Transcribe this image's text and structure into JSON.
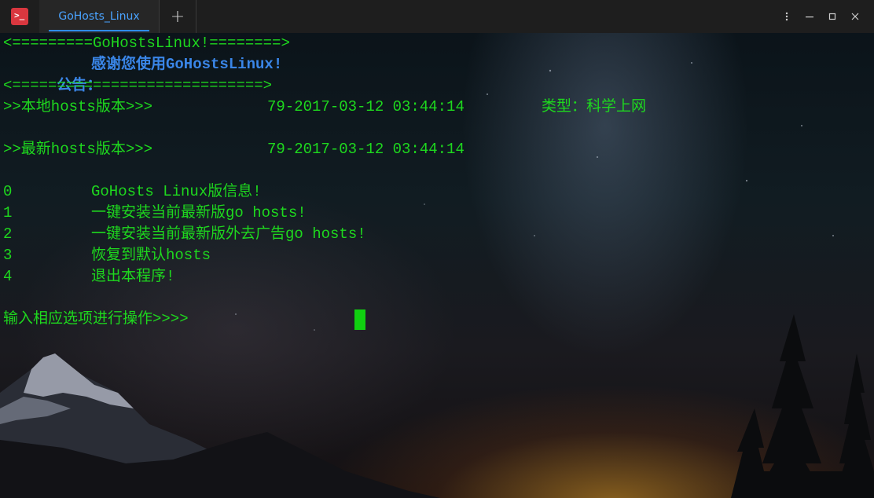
{
  "window": {
    "tab_title": "GoHosts_Linux",
    "new_tab_symbol": "+",
    "app_icon_glyph": "⌨",
    "controls": {
      "settings": "⁝",
      "minimize": "—",
      "maximize": "▫",
      "close": "✕"
    }
  },
  "terminal": {
    "banner_top": "<=========GoHostsLinux!========>",
    "notice_label": "公告：",
    "notice_text": "感谢您使用GoHostsLinux!",
    "banner_bottom": "<============================>",
    "local_version_label": ">>本地hosts版本>>>",
    "local_version_value": "79-2017-03-12 03:44:14",
    "type_label": "类型：科学上网",
    "latest_version_label": ">>最新hosts版本>>>",
    "latest_version_value": "79-2017-03-12 03:44:14",
    "menu": [
      {
        "key": "0",
        "label": "GoHosts Linux版信息!"
      },
      {
        "key": "1",
        "label": "一键安装当前最新版go hosts!"
      },
      {
        "key": "2",
        "label": "一键安装当前最新版外去广告go hosts!"
      },
      {
        "key": "3",
        "label": "恢复到默认hosts"
      },
      {
        "key": "4",
        "label": "退出本程序!"
      }
    ],
    "prompt": "输入相应选项进行操作>>>>"
  },
  "colors": {
    "text_green": "#1ed81e",
    "notice_blue": "#3a86e8",
    "tab_accent": "#2f8cff",
    "app_icon_red": "#d9373f"
  }
}
